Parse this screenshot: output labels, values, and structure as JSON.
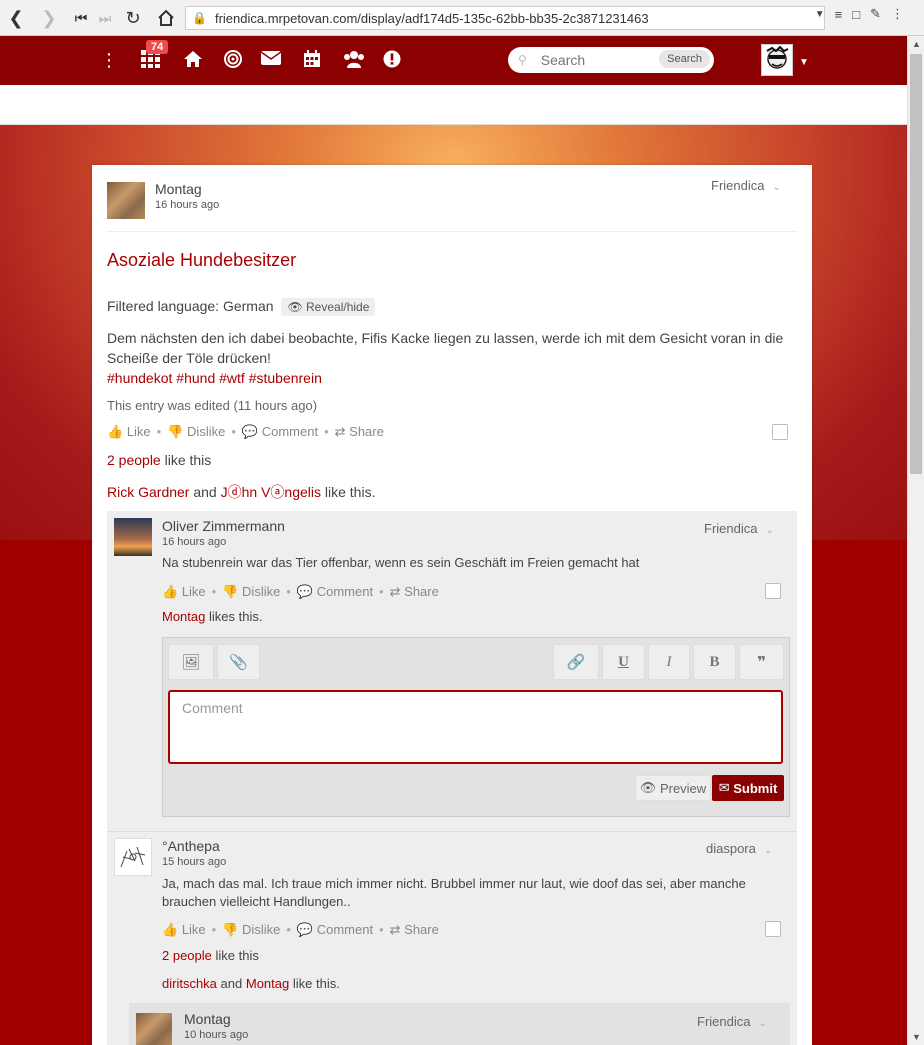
{
  "browser": {
    "url": "friendica.mrpetovan.com/display/adf174d5-135c-62bb-bb35-2c3871231463"
  },
  "navbar": {
    "notification_count": "74",
    "search_placeholder": "Search",
    "search_button": "Search"
  },
  "post": {
    "author": "Montag",
    "time": "16 hours ago",
    "network": "Friendica",
    "title": "Asoziale Hundebesitzer",
    "language_label": "Filtered language: German",
    "reveal_label": "Reveal/hide",
    "body": "Dem nächsten den ich dabei beobachte, Fifis Kacke liegen zu lassen, werde ich mit dem Gesicht voran in die Scheiße der Töle drücken!",
    "tags": [
      "#hundekot",
      "#hund",
      "#wtf",
      "#stubenrein"
    ],
    "edited": "This entry was edited (11 hours ago)",
    "actions": {
      "like": "Like",
      "dislike": "Dislike",
      "comment": "Comment",
      "share": "Share"
    },
    "likes_count": "2 people",
    "likes_suffix": "like this",
    "liker1": "Rick Gardner",
    "and": "and",
    "liker2": "Jⓓhn Vⓐngelis",
    "likers_suffix": "like this."
  },
  "comments": [
    {
      "author": "Oliver Zimmermann",
      "time": "16 hours ago",
      "network": "Friendica",
      "text": "Na stubenrein war das Tier offenbar, wenn es sein Geschäft im Freien gemacht hat",
      "liker": "Montag",
      "likes_suffix": "likes this."
    },
    {
      "author": "°Anthepa",
      "time": "15 hours ago",
      "network": "diaspora",
      "text": "Ja, mach das mal. Ich traue mich immer nicht. Brubbel immer nur laut, wie doof das sei, aber manche brauchen vielleicht Handlungen..",
      "likes_count": "2 people",
      "likes_suffix": "like this",
      "liker1": "diritschka",
      "and": "and",
      "liker2": "Montag",
      "likers_suffix": "like this."
    },
    {
      "author": "Montag",
      "time": "10 hours ago",
      "network": "Friendica"
    }
  ],
  "editor": {
    "placeholder": "Comment",
    "preview": "Preview",
    "submit": "Submit"
  }
}
